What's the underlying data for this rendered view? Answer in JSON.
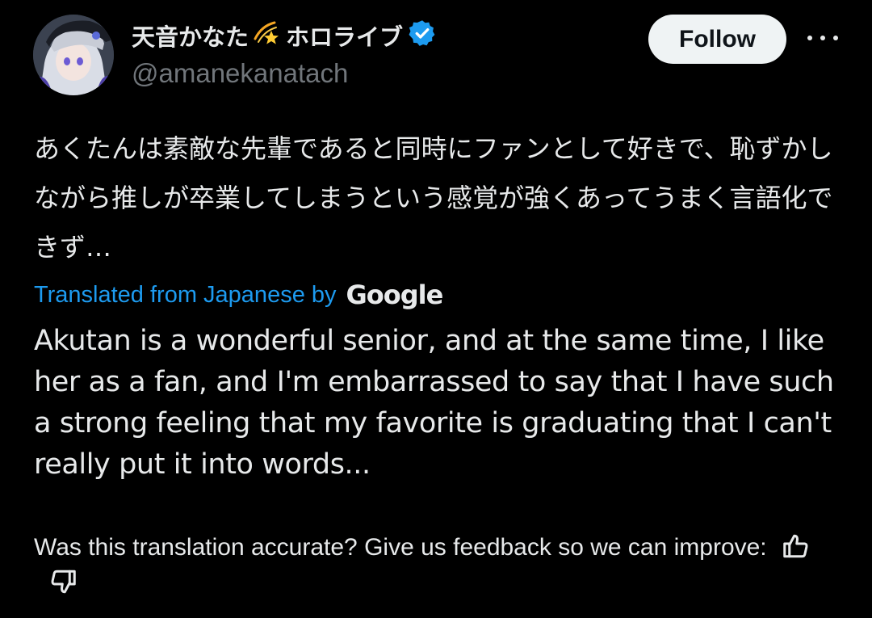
{
  "author": {
    "display_name": "天音かなた",
    "display_suffix": "ホロライブ",
    "handle": "@amanekanatach",
    "verified": true,
    "verified_badge_color": "#1d9bf0"
  },
  "actions": {
    "follow_label": "Follow",
    "more_icon": "more-horizontal-icon"
  },
  "tweet": {
    "text": "あくたんは素敵な先輩であると同時にファンとして好きで、恥ずかしながら推しが卒業してしまうという感覚が強くあってうまく言語化できず…"
  },
  "translation": {
    "label": "Translated from Japanese by",
    "provider": "Google",
    "text": "Akutan is a wonderful senior, and at the same time, I like her as a fan, and I'm embarrassed to say that I have such a strong feeling that my favorite is graduating that I can't really put it into words..."
  },
  "feedback": {
    "prompt": "Was this translation accurate? Give us feedback so we can improve:",
    "thumbs_up_icon": "thumbs-up-icon",
    "thumbs_down_icon": "thumbs-down-icon"
  },
  "colors": {
    "background": "#000000",
    "text": "#e7e9ea",
    "secondary_text": "#71767b",
    "link": "#1d9bf0",
    "follow_bg": "#eff3f4"
  }
}
